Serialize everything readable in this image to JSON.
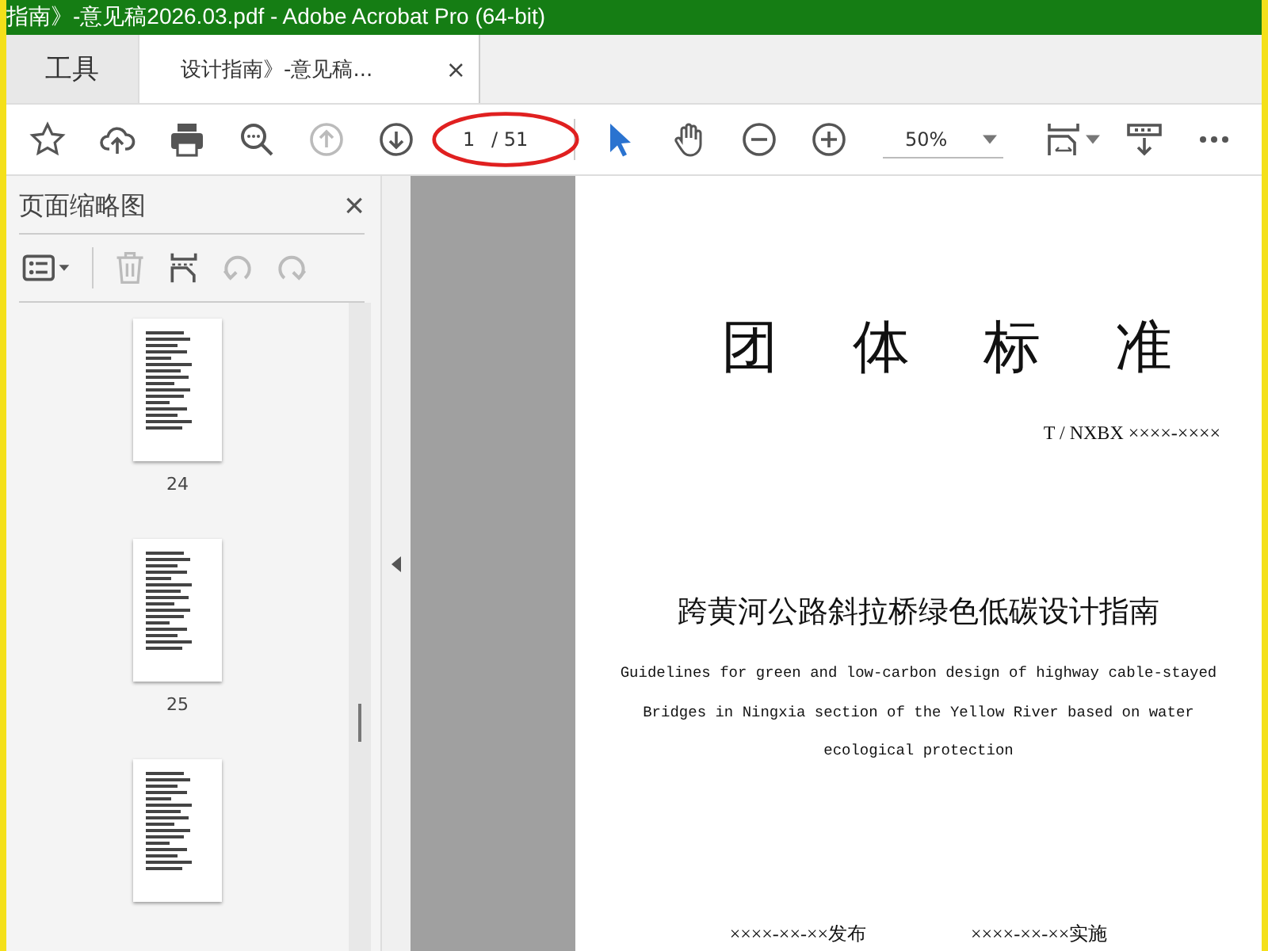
{
  "window": {
    "title": "指南》-意见稿2026.03.pdf - Adobe Acrobat Pro (64-bit)"
  },
  "tabs": [
    {
      "kind": "tools",
      "label": "工具",
      "selected": false
    },
    {
      "kind": "document",
      "label": "设计指南》-意见稿...",
      "selected": true,
      "close": "×"
    }
  ],
  "toolbar": {
    "page_value": "1",
    "page_total": "/ 51",
    "zoom": "50%"
  },
  "sidebar": {
    "title": "页面缩略图",
    "close": "×",
    "thumbnails": [
      {
        "label": "24",
        "selected": false
      },
      {
        "label": "25",
        "selected": false
      },
      {
        "selected": false
      }
    ]
  },
  "document": {
    "heading": "团体标准",
    "code": "T / NXBX ××××-××××",
    "title_cn": "跨黄河公路斜拉桥绿色低碳设计指南",
    "title_en": "Guidelines for green and low-carbon design of highway cable-stayed Bridges in Ningxia section of the Yellow River based on water ecological protection",
    "dates": [
      "××××-××-××发布",
      "××××-××-××实施"
    ]
  }
}
